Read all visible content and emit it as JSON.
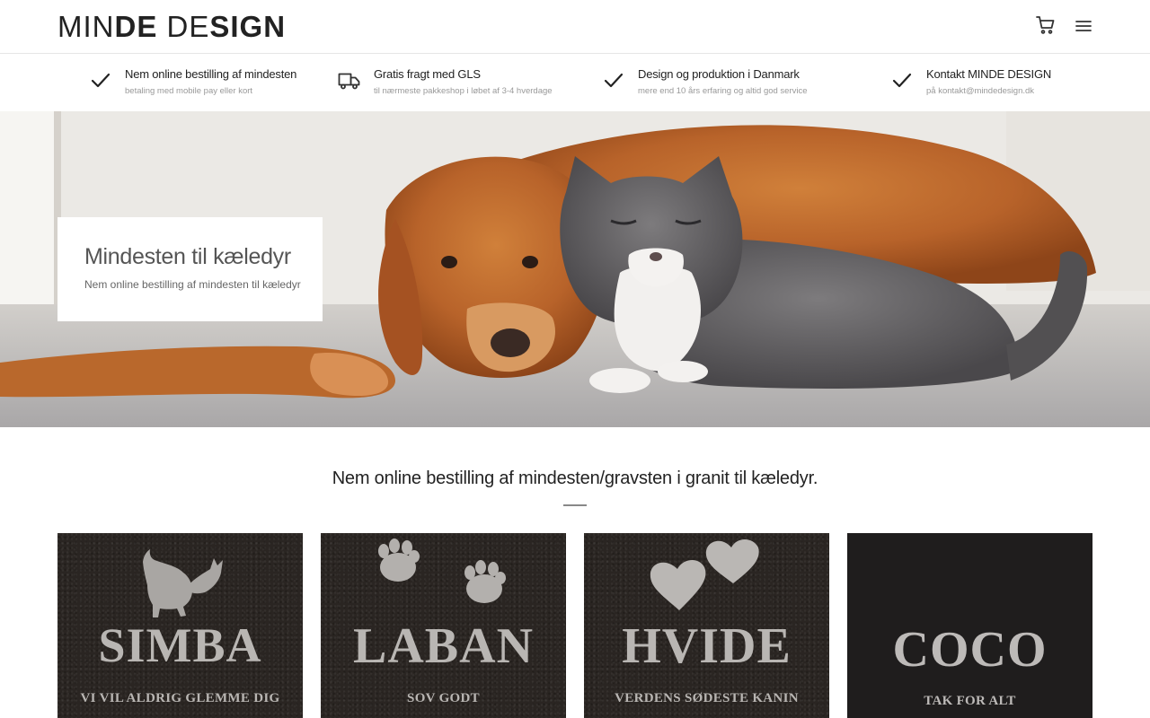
{
  "header": {
    "logo": {
      "part1": "MIN",
      "part2": "DE",
      "part3": " DE",
      "part4": "SIGN"
    },
    "icons": [
      "cart-icon",
      "menu-icon"
    ]
  },
  "usp_bar": [
    {
      "icon": "check-icon",
      "title": "Nem online bestilling af mindesten",
      "subtitle": "betaling med mobile pay eller kort"
    },
    {
      "icon": "truck-icon",
      "title": "Gratis fragt med GLS",
      "subtitle": "til nærmeste pakkeshop i løbet af 3-4 hverdage"
    },
    {
      "icon": "check-icon",
      "title": "Design og produktion i Danmark",
      "subtitle": "mere end 10 års erfaring og altid god service"
    },
    {
      "icon": "check-icon",
      "title": "Kontakt MINDE DESIGN",
      "subtitle": "på kontakt@mindedesign.dk"
    }
  ],
  "hero": {
    "title": "Mindesten til kæledyr",
    "subtitle": "Nem online bestilling af mindesten til kæledyr"
  },
  "section": {
    "title": "Nem online bestilling af mindesten/gravsten i granit til kæledyr."
  },
  "products": [
    {
      "motif": "cat-icon",
      "name": "SIMBA",
      "line": "VI VIL ALDRIG GLEMME DIG"
    },
    {
      "motif": "paw-prints-icon",
      "name": "LABAN",
      "line": "SOV GODT"
    },
    {
      "motif": "hearts-icon",
      "name": "HVIDE",
      "line": "VERDENS SØDESTE KANIN"
    },
    {
      "motif": "none",
      "name": "COCO",
      "line": "TAK FOR ALT"
    }
  ]
}
